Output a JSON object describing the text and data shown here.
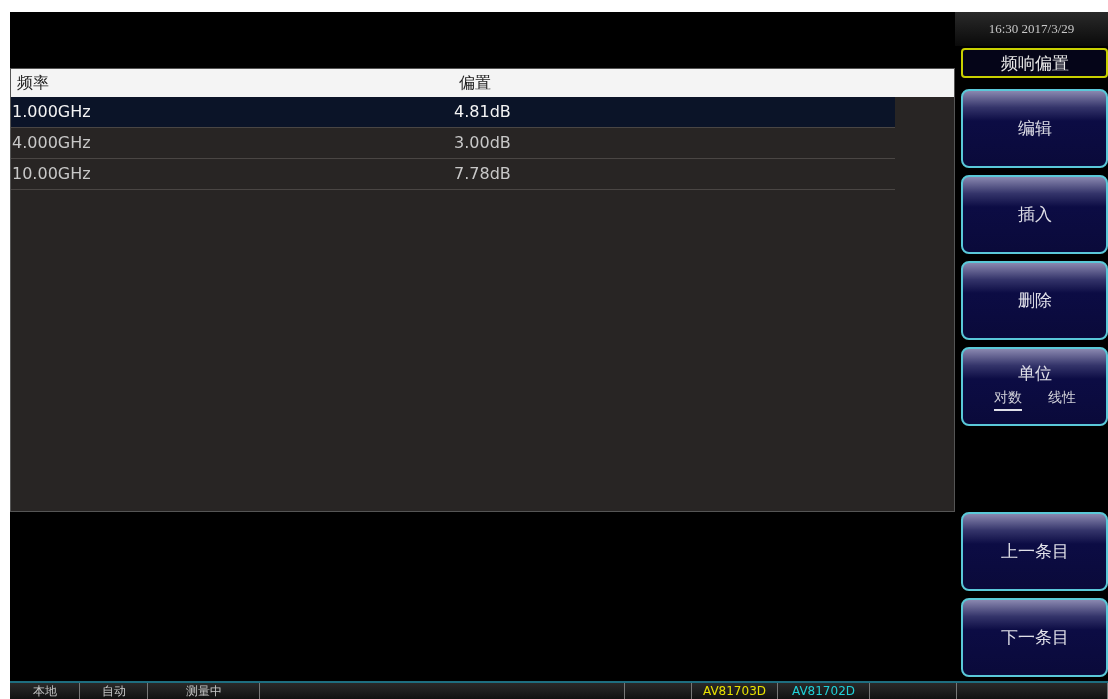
{
  "clock": "16:30  2017/3/29",
  "menu_title": "频响偏置",
  "table": {
    "columns": [
      "频率",
      "偏置"
    ],
    "rows": [
      {
        "cells": [
          "1.000GHz",
          "4.81dB"
        ],
        "selected": true
      },
      {
        "cells": [
          "4.000GHz",
          "3.00dB"
        ],
        "selected": false
      },
      {
        "cells": [
          "10.00GHz",
          "7.78dB"
        ],
        "selected": false
      }
    ]
  },
  "softkeys": [
    {
      "kind": "plain",
      "label": "编辑"
    },
    {
      "kind": "plain",
      "label": "插入"
    },
    {
      "kind": "plain",
      "label": "删除"
    },
    {
      "kind": "toggle",
      "label": "单位",
      "options": [
        {
          "label": "对数",
          "selected": true
        },
        {
          "label": "线性",
          "selected": false
        }
      ]
    },
    {
      "kind": "spacer"
    },
    {
      "kind": "plain",
      "label": "上一条目"
    },
    {
      "kind": "plain",
      "label": "下一条目"
    }
  ],
  "status_bar": [
    {
      "kind": "text",
      "text": "本地"
    },
    {
      "kind": "text",
      "text": "自动"
    },
    {
      "kind": "text",
      "text": "测量中"
    },
    {
      "kind": "blank"
    },
    {
      "kind": "blank"
    },
    {
      "kind": "text",
      "text": "AV81703D",
      "color": "#e8e000"
    },
    {
      "kind": "text",
      "text": "AV81702D",
      "color": "#20d0d8"
    },
    {
      "kind": "blank"
    },
    {
      "kind": "blank"
    }
  ]
}
